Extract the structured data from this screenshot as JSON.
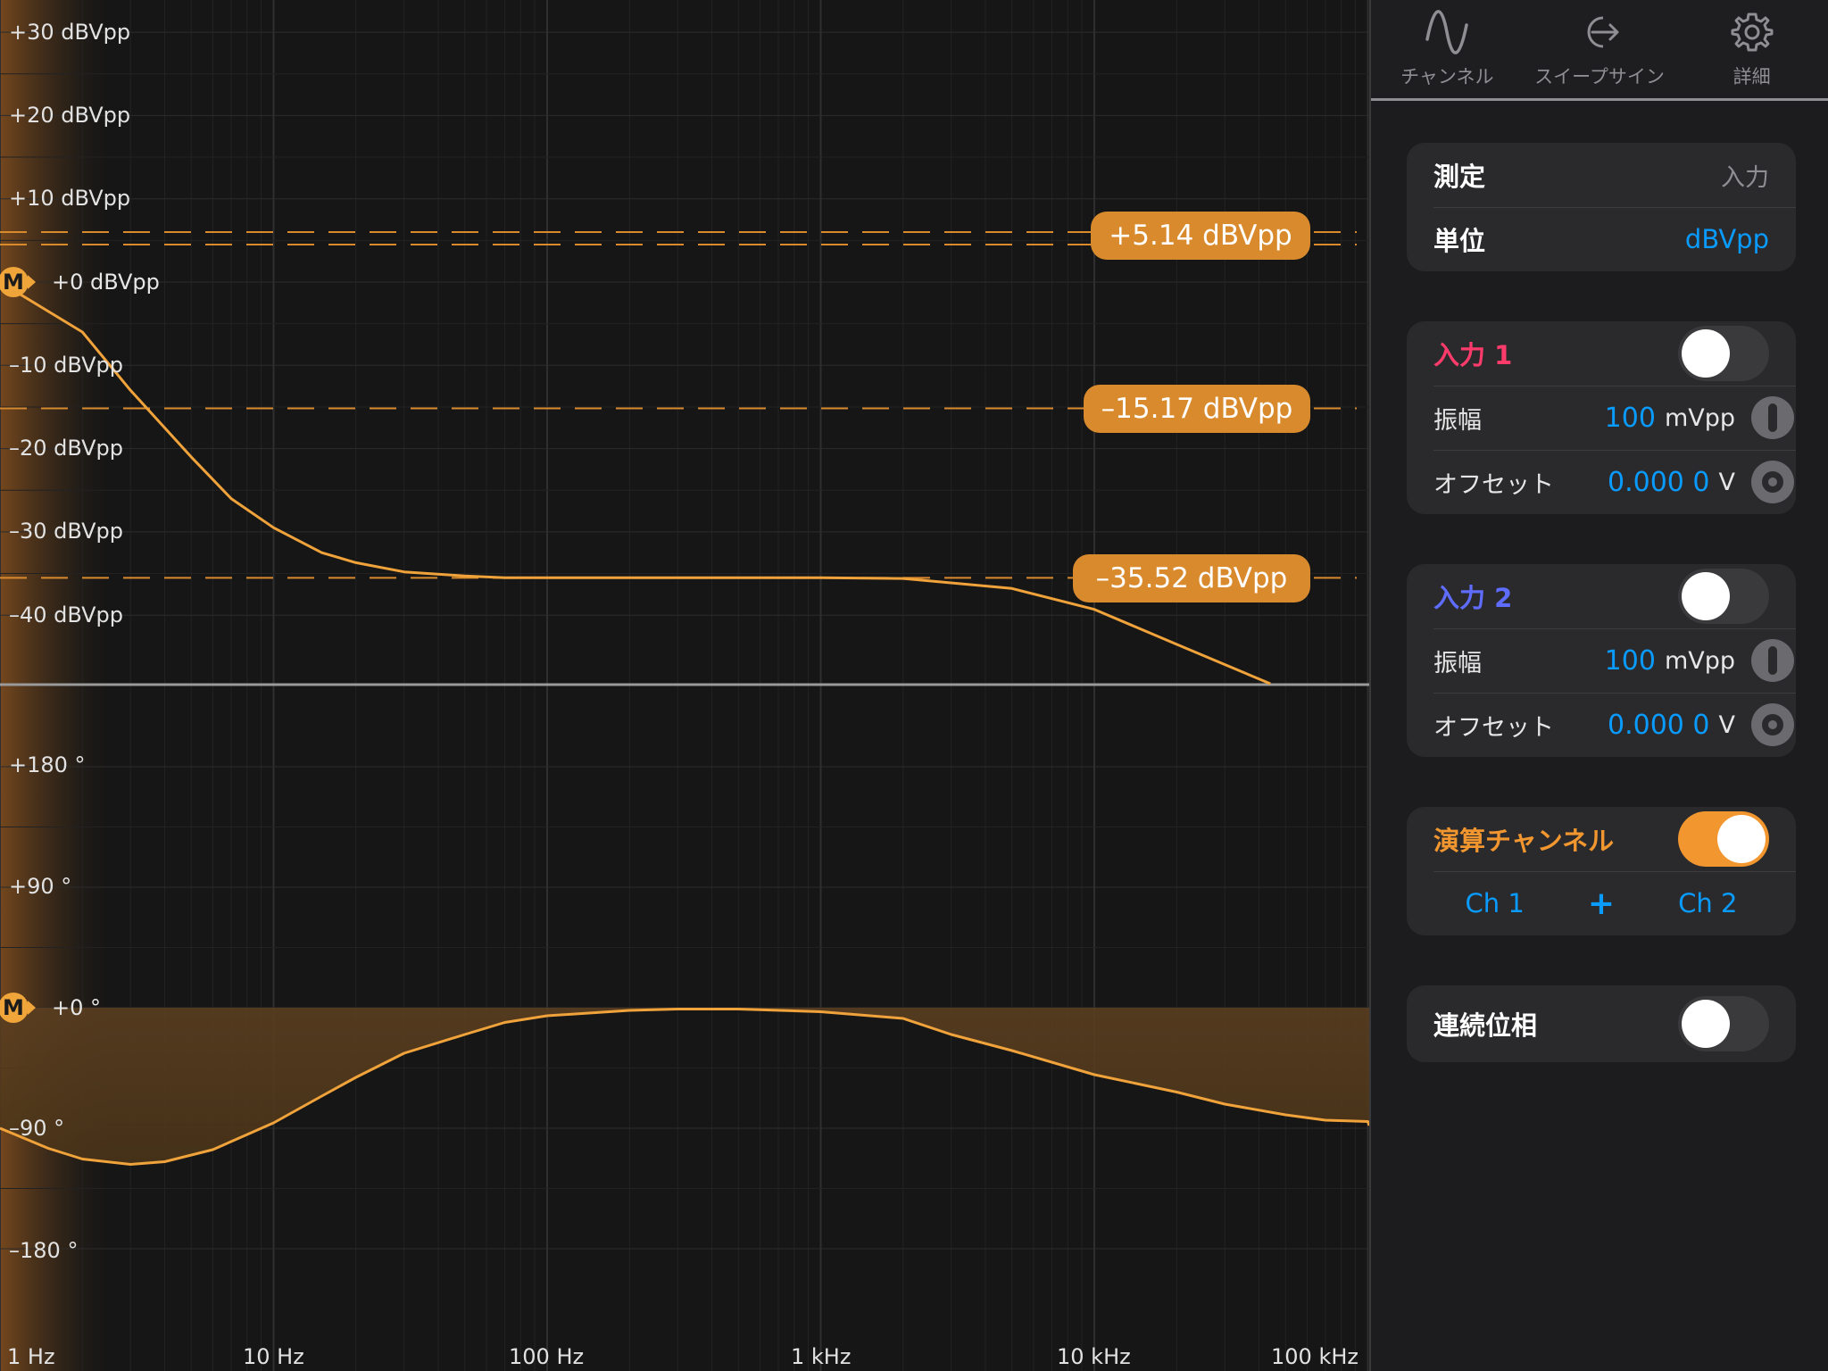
{
  "plot": {
    "magnitude_y_labels": [
      "+30 dBVpp",
      "+20 dBVpp",
      "+10 dBVpp",
      "+0 dBVpp",
      "–10 dBVpp",
      "–20 dBVpp",
      "–30 dBVpp",
      "–40 dBVpp"
    ],
    "phase_y_labels": [
      "+180 °",
      "+90 °",
      "+0 °",
      "–90 °",
      "–180 °"
    ],
    "x_labels": [
      "1 Hz",
      "10 Hz",
      "100 Hz",
      "1 kHz",
      "10 kHz",
      "100 kHz"
    ],
    "marker_letter": "M",
    "cursors": [
      "+5.14 dBVpp",
      "–15.17 dBVpp",
      "–35.52 dBVpp"
    ],
    "cursor_values": [
      5.14,
      -15.17,
      -35.52
    ],
    "colors": {
      "trace": "#f0a23b",
      "cursor_fill": "#d98a2d",
      "accent_blue": "#0a9bff",
      "input1": "#ff3b6b",
      "input2": "#5e6cff",
      "math": "#f2962f"
    }
  },
  "chart_data": [
    {
      "type": "line",
      "xscale": "log",
      "xlim": [
        1,
        150000
      ],
      "ylim": [
        -45,
        35
      ],
      "ylabel": "",
      "xlabel": "",
      "x": [
        1,
        2,
        3,
        5,
        7,
        10,
        15,
        20,
        30,
        50,
        70,
        100,
        200,
        500,
        1000,
        2000,
        5000,
        10000,
        20000,
        50000
      ],
      "y": [
        0,
        -6,
        -13,
        -21,
        -26,
        -29.5,
        -32.5,
        -33.7,
        -34.8,
        -35.3,
        -35.5,
        -35.5,
        -35.5,
        -35.5,
        -35.5,
        -35.6,
        -36.8,
        -39.3,
        -43.5,
        -49
      ]
    },
    {
      "type": "area",
      "xscale": "log",
      "xlim": [
        1,
        150000
      ],
      "ylim": [
        -200,
        200
      ],
      "x": [
        1,
        1.5,
        2,
        3,
        4,
        6,
        10,
        15,
        20,
        30,
        50,
        70,
        100,
        200,
        300,
        500,
        1000,
        2000,
        3000,
        5000,
        10000,
        20000,
        30000,
        50000,
        70000,
        100000,
        150000
      ],
      "y": [
        -90,
        -105,
        -113,
        -117,
        -115,
        -106,
        -86,
        -66,
        -52,
        -34,
        -20,
        -11,
        -6,
        -2,
        -1,
        -1,
        -3,
        -8,
        -20,
        -32,
        -50,
        -63,
        -72,
        -80,
        -84,
        -85,
        -88
      ]
    }
  ],
  "sidebar": {
    "tabs": [
      {
        "label": "チャンネル",
        "icon": "sine-wave-icon"
      },
      {
        "label": "スイープサイン",
        "icon": "sweep-output-icon"
      },
      {
        "label": "詳細",
        "icon": "gear-icon"
      }
    ],
    "measure": {
      "label": "測定",
      "value": "入力"
    },
    "unit": {
      "label": "単位",
      "value": "dBVpp"
    },
    "input1": {
      "title": "入力 1",
      "toggle_on": false,
      "amplitude_label": "振幅",
      "amplitude_value": "100",
      "amplitude_unit": "mVpp",
      "offset_label": "オフセット",
      "offset_value": "0.000 0",
      "offset_unit": "V"
    },
    "input2": {
      "title": "入力 2",
      "toggle_on": false,
      "amplitude_label": "振幅",
      "amplitude_value": "100",
      "amplitude_unit": "mVpp",
      "offset_label": "オフセット",
      "offset_value": "0.000 0",
      "offset_unit": "V"
    },
    "math": {
      "title": "演算チャンネル",
      "toggle_on": true,
      "operand1": "Ch 1",
      "operator": "+",
      "operand2": "Ch 2"
    },
    "unwrap_phase": {
      "label": "連続位相",
      "toggle_on": false
    }
  }
}
